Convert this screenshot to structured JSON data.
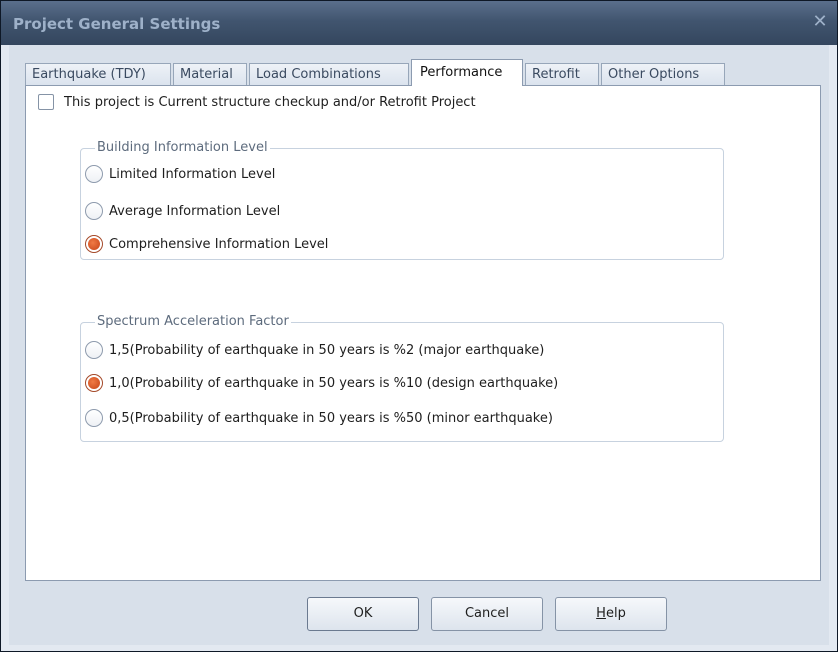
{
  "window": {
    "title": "Project General Settings",
    "close_label": "✕"
  },
  "tabs": [
    {
      "label": "Earthquake (TDY)"
    },
    {
      "label": "Material"
    },
    {
      "label": "Load Combinations"
    },
    {
      "label": "Performance",
      "active": true
    },
    {
      "label": "Retrofit"
    },
    {
      "label": "Other Options"
    }
  ],
  "retrofit_checkbox": {
    "label": "This project is Current structure checkup and/or Retrofit Project",
    "checked": false
  },
  "building_information_level": {
    "legend": "Building Information Level",
    "options": [
      {
        "label": "Limited Information Level",
        "checked": false
      },
      {
        "label": "Average Information Level",
        "checked": false
      },
      {
        "label": "Comprehensive Information Level",
        "checked": true
      }
    ]
  },
  "spectrum_acceleration_factor": {
    "legend": "Spectrum Acceleration Factor",
    "options": [
      {
        "label": "1,5(Probability of earthquake in 50 years is %2 (major earthquake)",
        "checked": false
      },
      {
        "label": "1,0(Probability of earthquake in 50 years is %10 (design earthquake)",
        "checked": true
      },
      {
        "label": "0,5(Probability of earthquake in 50 years is %50 (minor earthquake)",
        "checked": false
      }
    ]
  },
  "buttons": {
    "ok": "OK",
    "cancel": "Cancel",
    "help_mnemonic": "H",
    "help_rest": "elp"
  },
  "colors": {
    "accent_radio": "#d8582a",
    "title_bar": "#41556f"
  }
}
